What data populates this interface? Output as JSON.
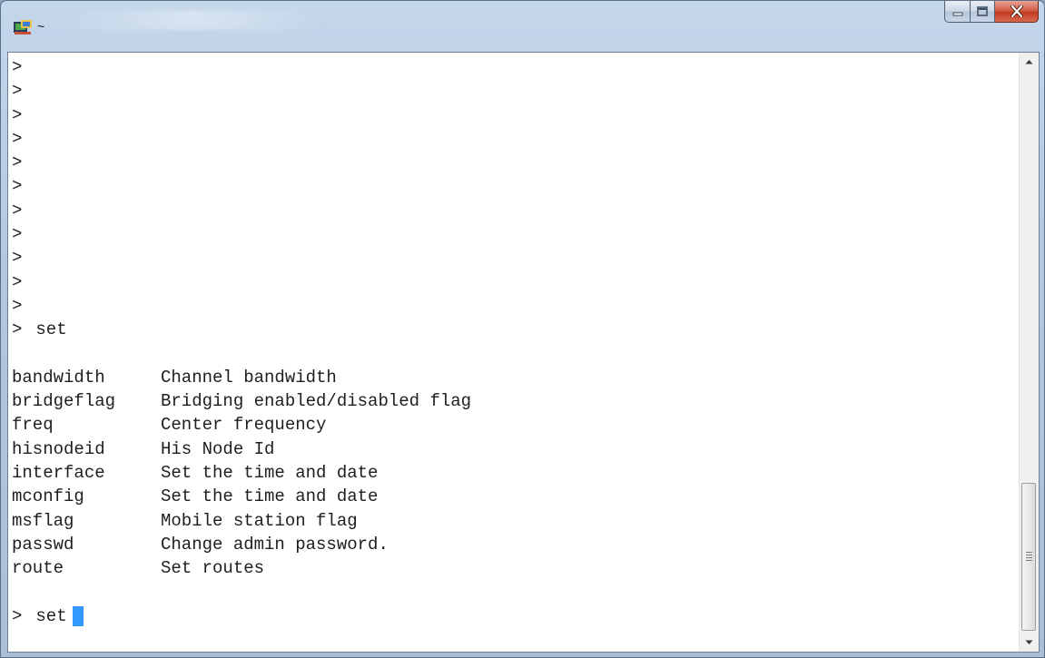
{
  "window": {
    "title": "~",
    "buttons": {
      "minimize_icon": "minimize-icon",
      "maximize_icon": "maximize-icon",
      "close_icon": "close-icon",
      "close_color": "#c23b22"
    }
  },
  "terminal": {
    "prompt": ">",
    "empty_prompt_lines": 11,
    "entered_command": "set",
    "help_entries": [
      {
        "name": "bandwidth",
        "description": "Channel bandwidth"
      },
      {
        "name": "bridgeflag",
        "description": "Bridging enabled/disabled flag"
      },
      {
        "name": "freq",
        "description": "Center frequency"
      },
      {
        "name": "hisnodeid",
        "description": "His Node Id"
      },
      {
        "name": "interface",
        "description": "Set the time and date"
      },
      {
        "name": "mconfig",
        "description": "Set the time and date"
      },
      {
        "name": "msflag",
        "description": "Mobile station flag"
      },
      {
        "name": "passwd",
        "description": "Change admin password."
      },
      {
        "name": "route",
        "description": "Set routes"
      }
    ],
    "current_input": "set",
    "cursor_color": "#3399ff"
  },
  "scrollbar": {
    "up_icon": "scroll-up-icon",
    "down_icon": "scroll-down-icon",
    "position_fraction": 1.0
  }
}
